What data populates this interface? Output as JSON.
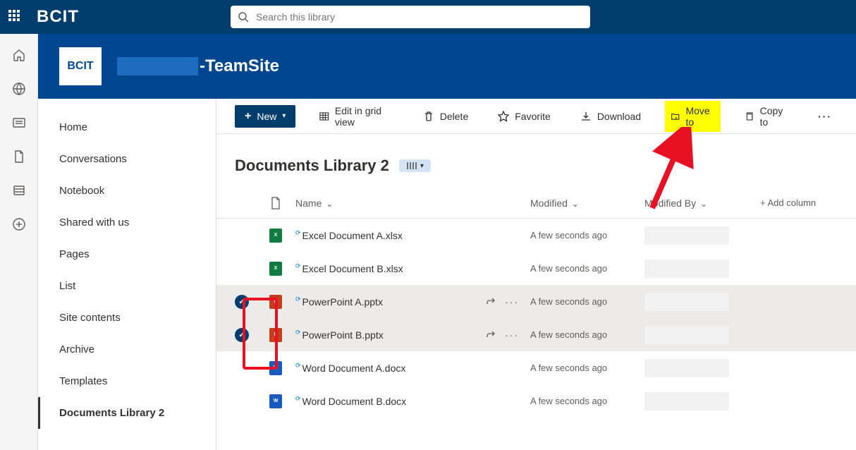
{
  "top": {
    "brand": "BCIT",
    "search_placeholder": "Search this library"
  },
  "site": {
    "logo_text": "BCIT",
    "name_suffix": "-TeamSite"
  },
  "nav": {
    "items": [
      {
        "label": "Home"
      },
      {
        "label": "Conversations"
      },
      {
        "label": "Notebook"
      },
      {
        "label": "Shared with us"
      },
      {
        "label": "Pages"
      },
      {
        "label": "List"
      },
      {
        "label": "Site contents"
      },
      {
        "label": "Archive"
      },
      {
        "label": "Templates"
      },
      {
        "label": "Documents Library 2"
      }
    ]
  },
  "toolbar": {
    "new": "New",
    "edit_grid": "Edit in grid view",
    "delete": "Delete",
    "favorite": "Favorite",
    "download": "Download",
    "move_to": "Move to",
    "copy_to": "Copy to"
  },
  "library": {
    "title": "Documents Library 2",
    "columns": {
      "name": "Name",
      "modified": "Modified",
      "modified_by": "Modified By",
      "add": "Add column"
    },
    "rows": [
      {
        "type": "excel",
        "name": "Excel Document A.xlsx",
        "modified": "A few seconds ago",
        "selected": false
      },
      {
        "type": "excel",
        "name": "Excel Document B.xlsx",
        "modified": "A few seconds ago",
        "selected": false
      },
      {
        "type": "ppt",
        "name": "PowerPoint A.pptx",
        "modified": "A few seconds ago",
        "selected": true
      },
      {
        "type": "ppt",
        "name": "PowerPoint B.pptx",
        "modified": "A few seconds ago",
        "selected": true
      },
      {
        "type": "word",
        "name": "Word Document A.docx",
        "modified": "A few seconds ago",
        "selected": false
      },
      {
        "type": "word",
        "name": "Word Document B.docx",
        "modified": "A few seconds ago",
        "selected": false
      }
    ]
  }
}
